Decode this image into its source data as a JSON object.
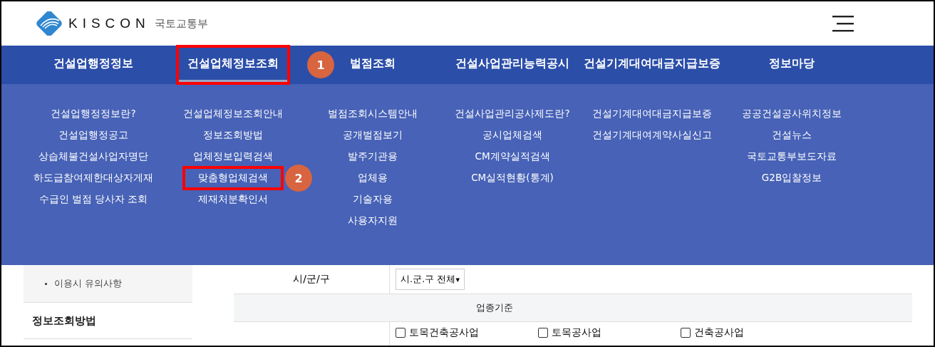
{
  "header": {
    "logo_text": "KISCON",
    "ministry": "국토교통부"
  },
  "nav": [
    {
      "label": "건설업행정정보",
      "selected": false,
      "children": [
        {
          "label": "건설업행정정보란?"
        },
        {
          "label": "건설업행정공고"
        },
        {
          "label": "상습체불건설사업자명단"
        },
        {
          "label": "하도급참여제한대상자게재"
        },
        {
          "label": "수급인 벌점 당사자 조회"
        }
      ]
    },
    {
      "label": "건설업체정보조회",
      "selected": true,
      "marker": "1",
      "children": [
        {
          "label": "건설업체정보조회안내"
        },
        {
          "label": "정보조회방법"
        },
        {
          "label": "업체정보입력검색"
        },
        {
          "label": "맞춤형업체검색",
          "marker": "2"
        },
        {
          "label": "제재처분확인서"
        }
      ]
    },
    {
      "label": "벌점조회",
      "selected": false,
      "children": [
        {
          "label": "벌점조회시스템안내"
        },
        {
          "label": "공개벌점보기"
        },
        {
          "label": "발주기관용"
        },
        {
          "label": "업체용"
        },
        {
          "label": "기술자용"
        },
        {
          "label": "사용자지원"
        }
      ]
    },
    {
      "label": "건설사업관리능력공시",
      "selected": false,
      "children": [
        {
          "label": "건설사업관리공사제도란?"
        },
        {
          "label": "공시업체검색"
        },
        {
          "label": "CM계약실적검색"
        },
        {
          "label": "CM실적현황(통계)"
        }
      ]
    },
    {
      "label": "건설기계대여대금지급보증",
      "selected": false,
      "children": [
        {
          "label": "건설기계대여대금지급보증"
        },
        {
          "label": "건설기계대여계약사실신고"
        }
      ]
    },
    {
      "label": "정보마당",
      "selected": false,
      "children": [
        {
          "label": "공공건설공사위치정보"
        },
        {
          "label": "건설뉴스"
        },
        {
          "label": "국토교통부보도자료"
        },
        {
          "label": "G2B입찰정보"
        }
      ]
    }
  ],
  "sidebar": {
    "items": [
      {
        "label": "이용시 유의사항"
      }
    ],
    "section": "정보조회방법"
  },
  "form": {
    "district_label": "시/군/구",
    "district_select": "시.군.구 전체",
    "select_caret": "▾",
    "industry_header": "업종기준",
    "industries": [
      {
        "label": "토목건축공사업",
        "checked": false
      },
      {
        "label": "토목공사업",
        "checked": false
      },
      {
        "label": "건축공사업",
        "checked": false
      }
    ]
  }
}
